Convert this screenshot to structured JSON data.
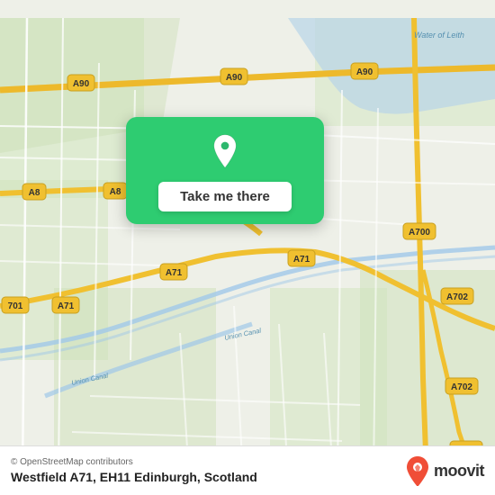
{
  "map": {
    "background_color": "#eef0e8",
    "road_color": "#ffffff",
    "road_secondary_color": "#f5d78a",
    "road_major_color": "#f5c842",
    "water_color": "#b8d8f0",
    "green_area_color": "#c8ddb0"
  },
  "card": {
    "background_color": "#2db86e",
    "button_label": "Take me there",
    "pin_color": "#ffffff"
  },
  "bottom_bar": {
    "osm_credit": "© OpenStreetMap contributors",
    "location_title": "Westfield A71, EH11 Edinburgh, Scotland",
    "moovit_label": "moovit"
  }
}
